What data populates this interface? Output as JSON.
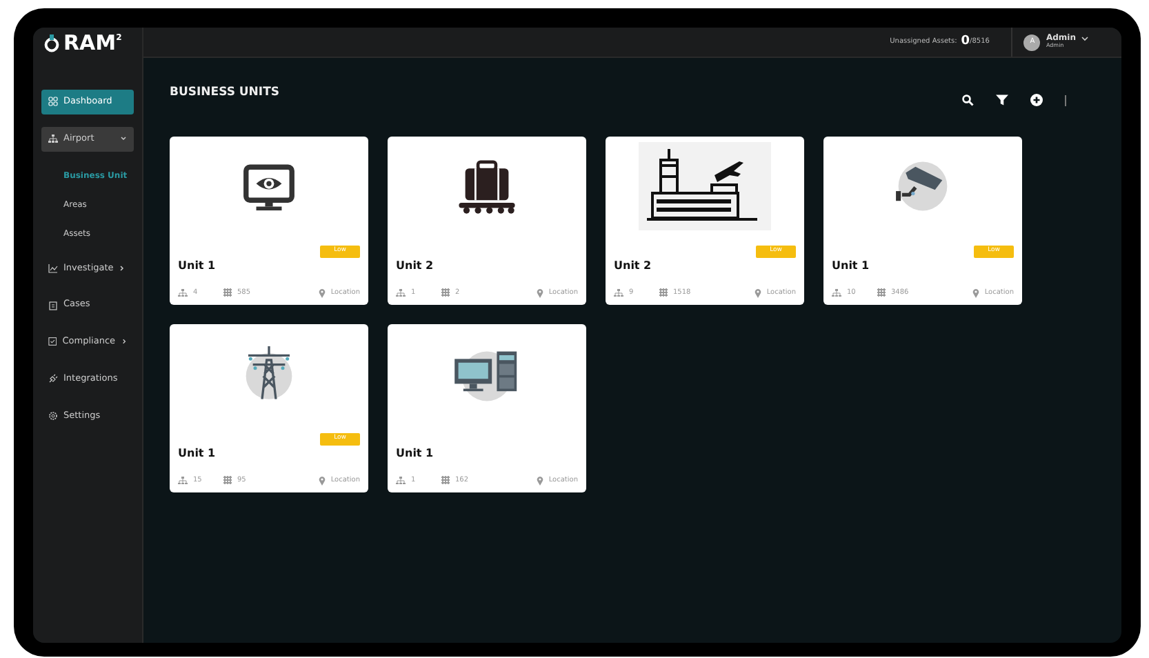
{
  "brand": {
    "name": "RAM",
    "sup": "2"
  },
  "topbar": {
    "unassigned_label": "Unassigned Assets:",
    "unassigned_count": "0",
    "unassigned_total": "/8516",
    "user": {
      "avatar": "A",
      "name": "Admin",
      "role": "Admin"
    }
  },
  "sidebar": {
    "items": [
      {
        "label": "Dashboard",
        "kind": "grid",
        "selected": true
      },
      {
        "label": "Airport",
        "kind": "hierarchy",
        "selected": false,
        "expanded": true,
        "children": [
          {
            "label": "Business Unit",
            "selected": true
          },
          {
            "label": "Areas",
            "selected": false
          },
          {
            "label": "Assets",
            "selected": false
          }
        ]
      },
      {
        "label": "Investigate",
        "kind": "chart",
        "selected": false,
        "expanded": false
      },
      {
        "label": "Cases",
        "kind": "clipboard",
        "selected": false
      },
      {
        "label": "Compliance",
        "kind": "check",
        "selected": false,
        "expanded": false
      },
      {
        "label": "Integrations",
        "kind": "plug",
        "selected": false
      },
      {
        "label": "Settings",
        "kind": "gear",
        "selected": false
      }
    ]
  },
  "page": {
    "title": "BUSINESS UNITS"
  },
  "units": [
    {
      "kind": "monitor",
      "name": "Unit 1",
      "badge": "Low",
      "areas": "4",
      "assets": "585",
      "location": "Location"
    },
    {
      "kind": "luggage",
      "name": "Unit 2",
      "areas": "1",
      "assets": "2",
      "location": "Location"
    },
    {
      "kind": "airport",
      "name": "Unit 2",
      "badge": "Low",
      "areas": "9",
      "assets": "1518",
      "location": "Location"
    },
    {
      "kind": "camera",
      "name": "Unit 1",
      "badge": "Low",
      "areas": "10",
      "assets": "3486",
      "location": "Location"
    },
    {
      "kind": "tower",
      "name": "Unit 1",
      "badge": "Low",
      "areas": "15",
      "assets": "95",
      "location": "Location"
    },
    {
      "kind": "computer",
      "name": "Unit 1",
      "areas": "1",
      "assets": "162",
      "location": "Location"
    }
  ]
}
